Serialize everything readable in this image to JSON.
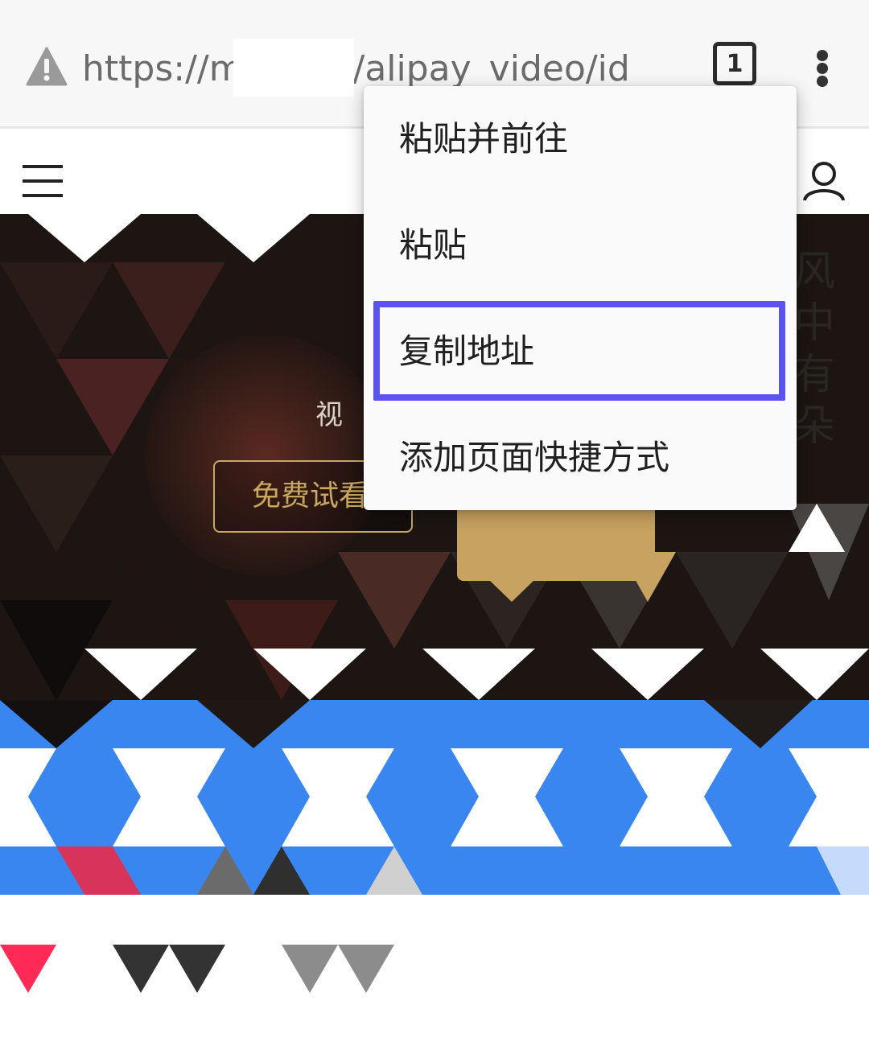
{
  "browser": {
    "url": "https://m.            .com/alipay_video/id_",
    "tab_count": "1"
  },
  "hero": {
    "promo_text": "视",
    "free_trial_label": "免费试看",
    "poster_title": "风中有朵"
  },
  "context_menu": {
    "items": [
      {
        "label": "粘贴并前往"
      },
      {
        "label": "粘贴"
      },
      {
        "label": "复制地址"
      },
      {
        "label": "添加页面快捷方式"
      }
    ],
    "highlighted_index": 2
  },
  "colors": {
    "accent_blue": "#3a86f0",
    "highlight_border": "#5b52ef",
    "gold": "#c7a261",
    "topbar_bg": "#f7f7f7"
  },
  "icons": {
    "security": "warning-triangle-icon",
    "tabs": "tab-switcher-icon",
    "more": "more-vert-icon",
    "menu": "hamburger-icon",
    "account": "user-icon"
  }
}
